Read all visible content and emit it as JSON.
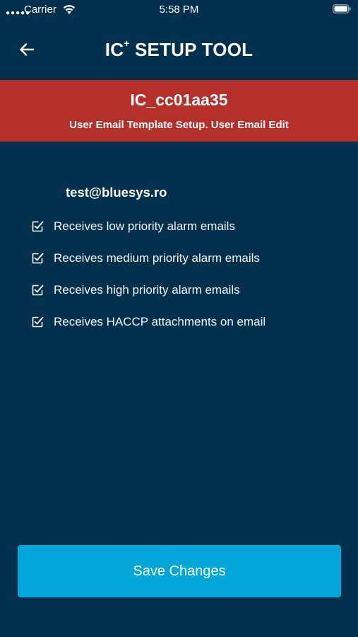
{
  "status_bar": {
    "carrier": "Carrier",
    "time": "5:58 PM"
  },
  "header": {
    "title_main": "IC",
    "title_sup": "+",
    "title_rest": " SETUP TOOL"
  },
  "banner": {
    "device_id": "IC_cc01aa35",
    "subtitle": "User Email Template Setup. User Email Edit"
  },
  "user": {
    "email": "test@bluesys.ro"
  },
  "options": [
    {
      "label": "Receives low priority alarm emails",
      "checked": true
    },
    {
      "label": "Receives medium priority alarm emails",
      "checked": true
    },
    {
      "label": "Receives high priority alarm emails",
      "checked": true
    },
    {
      "label": "Receives HACCP attachments on email",
      "checked": true
    }
  ],
  "actions": {
    "save_label": "Save Changes"
  },
  "colors": {
    "background": "#02304d",
    "banner": "#b52f2b",
    "button": "#04a6d9"
  }
}
